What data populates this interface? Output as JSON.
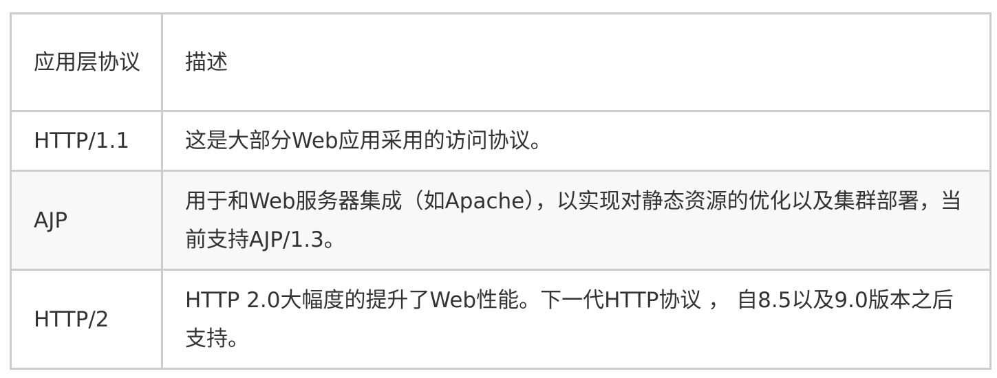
{
  "table": {
    "headers": [
      "应用层协议",
      "描述"
    ],
    "rows": [
      {
        "protocol": "HTTP/1.1",
        "description": "这是大部分Web应用采用的访问协议。"
      },
      {
        "protocol": "AJP",
        "description": "用于和Web服务器集成（如Apache），以实现对静态资源的优化以及集群部署，当前支持AJP/1.3。"
      },
      {
        "protocol": "HTTP/2",
        "description": "HTTP 2.0大幅度的提升了Web性能。下一代HTTP协议 ， 自8.5以及9.0版本之后支持。"
      }
    ]
  }
}
